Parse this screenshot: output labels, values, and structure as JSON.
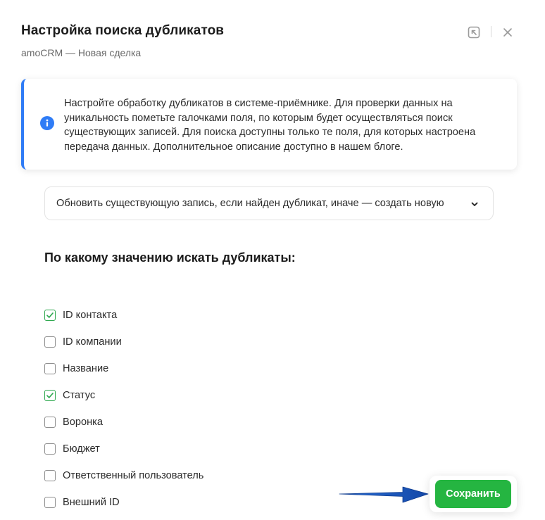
{
  "header": {
    "title": "Настройка поиска дубликатов",
    "subtitle": "amoCRM — Новая сделка"
  },
  "info": {
    "text": "Настройте обработку дубликатов в системе-приёмнике. Для проверки данных на уникальность пометьте галочками поля, по которым будет осуществляться поиск существующих записей. Для поиска доступны только те поля, для которых настроена передача данных. Дополнительное описание доступно в нашем блоге.",
    "accent_color": "#2f7cf6",
    "icon": "info-icon"
  },
  "dedupe_mode": {
    "selected": "Обновить существующую запись, если найден дубликат, иначе — создать новую"
  },
  "section": {
    "title": "По какому значению искать дубликаты:"
  },
  "fields": [
    {
      "label": "ID контакта",
      "checked": true
    },
    {
      "label": "ID компании",
      "checked": false
    },
    {
      "label": "Название",
      "checked": false
    },
    {
      "label": "Статус",
      "checked": true
    },
    {
      "label": "Воронка",
      "checked": false
    },
    {
      "label": "Бюджет",
      "checked": false
    },
    {
      "label": "Ответственный пользователь",
      "checked": false
    },
    {
      "label": "Внешний ID",
      "checked": false
    }
  ],
  "actions": {
    "save_label": "Сохранить",
    "save_color": "#25b541"
  },
  "colors": {
    "check_green": "#2fa84f",
    "arrow_blue": "#1a5bbf"
  }
}
